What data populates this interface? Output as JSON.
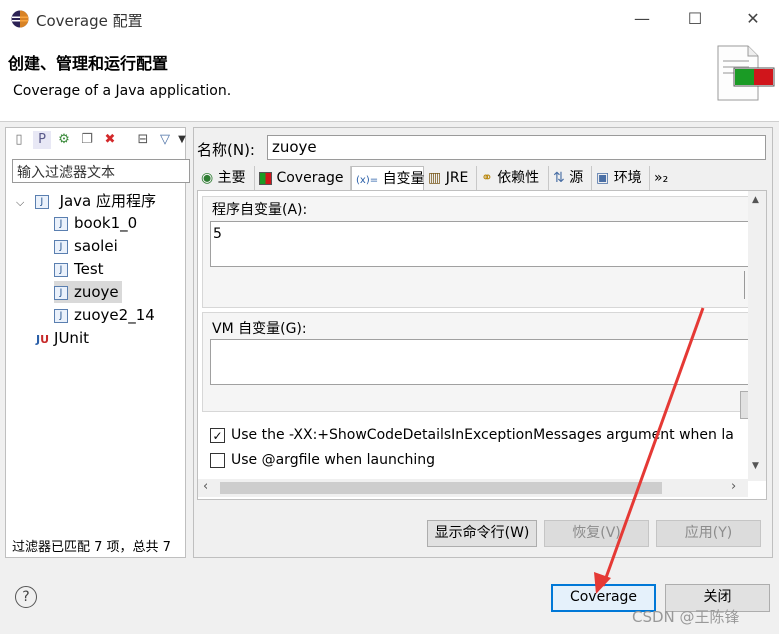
{
  "window": {
    "title": "Coverage 配置",
    "minimize": "—",
    "maximize": "☐",
    "close": "✕"
  },
  "header": {
    "title": "创建、管理和运行配置",
    "subtitle": "Coverage of a Java application."
  },
  "left": {
    "filter_placeholder": "输入过滤器文本",
    "tree": [
      {
        "label": "Java 应用程序",
        "expanded": true
      },
      {
        "label": "book1_0"
      },
      {
        "label": "saolei"
      },
      {
        "label": "Test"
      },
      {
        "label": "zuoye",
        "selected": true
      },
      {
        "label": "zuoye2_14"
      },
      {
        "label": "JUnit"
      }
    ],
    "status": "过滤器已匹配 7 项，总共 7"
  },
  "config": {
    "name_label": "名称(N):",
    "name_value": "zuoye",
    "tabs": [
      "主要",
      "Coverage",
      "自变量",
      "JRE",
      "依赖性",
      "源",
      "环境",
      "»₂"
    ],
    "active_tab": "自变量",
    "program_args_label": "程序自变量(A):",
    "program_args_value": "5",
    "vm_args_label": "VM 自变量(G):",
    "vm_args_value": "",
    "check1_label": "Use the -XX:+ShowCodeDetailsInExceptionMessages argument when la",
    "check1_checked": true,
    "check2_label": "Use @argfile when launching",
    "check2_checked": false,
    "btn_show_cmd": "显示命令行(W)",
    "btn_revert": "恢复(V)",
    "btn_apply": "应用(Y)"
  },
  "footer": {
    "help": "?",
    "btn_run": "Coverage",
    "btn_close": "关闭",
    "watermark": "CSDN @王陈锋"
  },
  "colors": {
    "accent": "#0078d7",
    "annotation_arrow": "#e53935"
  }
}
